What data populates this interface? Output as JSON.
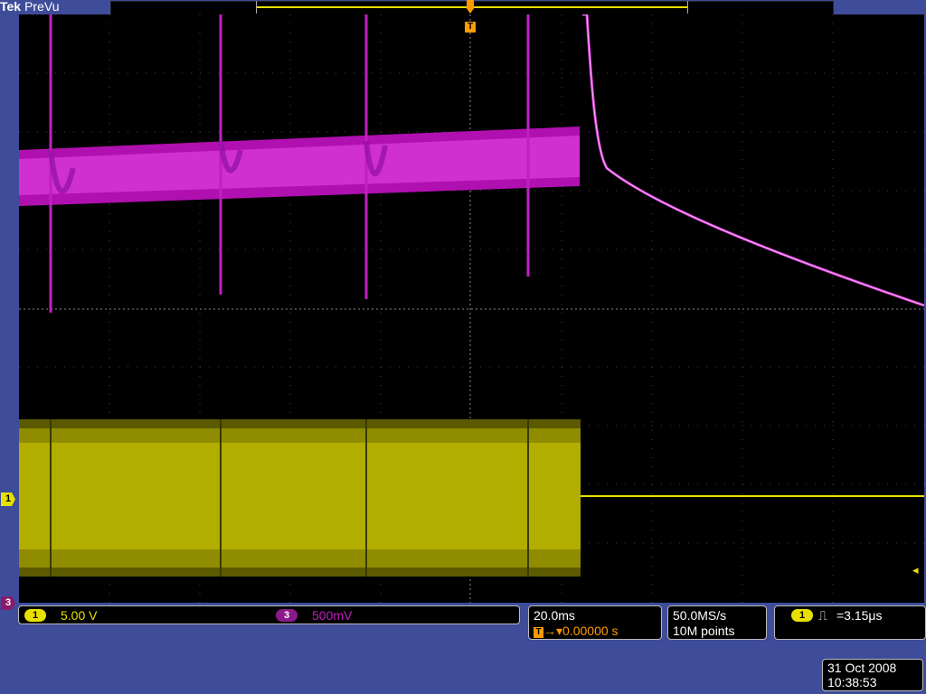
{
  "header": {
    "brand": "Tek",
    "mode": "PreVu",
    "trigger_label": "T"
  },
  "markers": {
    "ch1": "1",
    "ch3": "3"
  },
  "channels": [
    {
      "id": "1",
      "scale": "5.00 V",
      "color": "#e8e000"
    },
    {
      "id": "3",
      "scale": "500mV",
      "color": "#c020c0"
    }
  ],
  "horizontal": {
    "time_per_div": "20.0ms",
    "trigger_position": "0.00000 s",
    "trigger_symbol": "T"
  },
  "acquisition": {
    "sample_rate": "50.0MS/s",
    "record_length": "10M points"
  },
  "trigger": {
    "source": "1",
    "type_symbol": "⎍",
    "value": "=3.15μs"
  },
  "datetime": {
    "date": "31 Oct  2008",
    "time": "10:38:53"
  },
  "colors": {
    "background": "#3f4c9a",
    "ch1": "#e8e000",
    "ch3": "#c020c0",
    "trigger": "#ff9a00"
  }
}
